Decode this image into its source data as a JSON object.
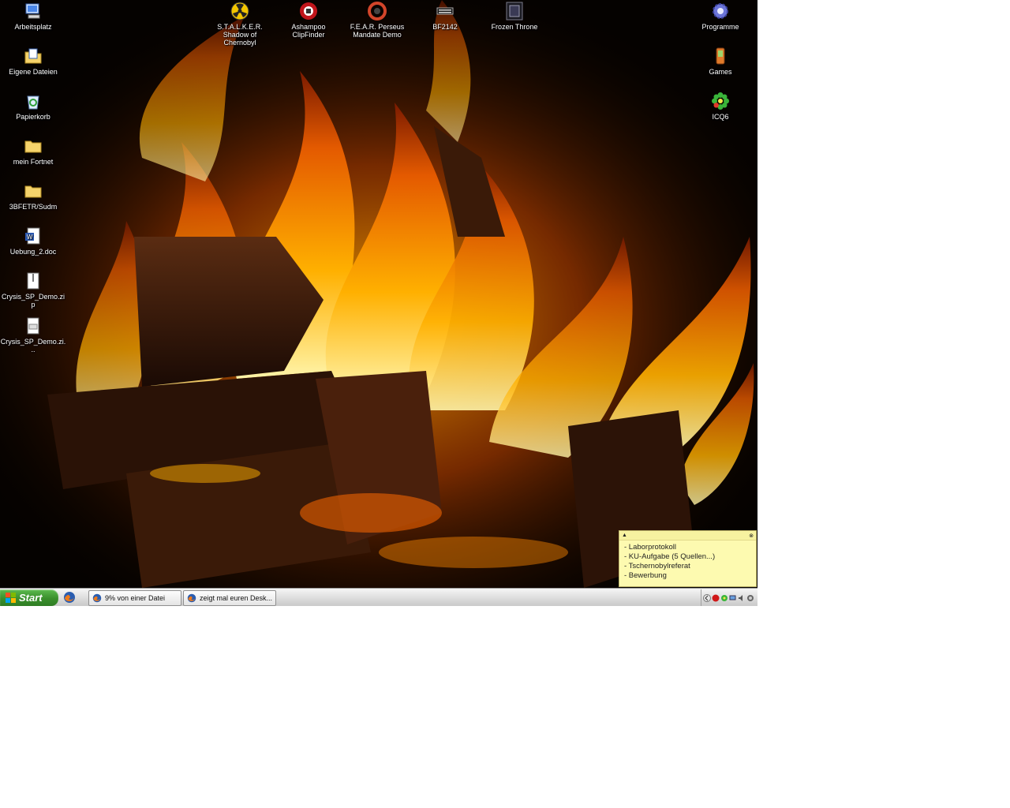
{
  "desktop": {
    "left_icons": [
      {
        "label": "Arbeitsplatz",
        "icon": "my-computer-icon"
      },
      {
        "label": "Eigene Dateien",
        "icon": "my-documents-icon"
      },
      {
        "label": "Papierkorb",
        "icon": "recycle-bin-icon"
      },
      {
        "label": "mein Fortnet",
        "icon": "folder-icon"
      },
      {
        "label": "3BFETR/Sudm",
        "icon": "folder-icon"
      },
      {
        "label": "Uebung_2.doc",
        "icon": "word-document-icon"
      },
      {
        "label": "Crysis_SP_Demo.zip",
        "icon": "zip-file-icon"
      },
      {
        "label": "Crysis_SP_Demo.zi...",
        "icon": "text-file-icon"
      }
    ],
    "top_icons": [
      {
        "label": "S.T.A.L.K.E.R. Shadow of Chernobyl",
        "icon": "radiation-icon"
      },
      {
        "label": "Ashampoo ClipFinder",
        "icon": "clipfinder-icon"
      },
      {
        "label": "F.E.A.R. Perseus Mandate Demo",
        "icon": "fear-icon"
      },
      {
        "label": "BF2142",
        "icon": "bf2142-icon"
      },
      {
        "label": "Frozen Throne",
        "icon": "frozen-throne-icon"
      }
    ],
    "right_icons": [
      {
        "label": "Programme",
        "icon": "gear-icon"
      },
      {
        "label": "Games",
        "icon": "pda-icon"
      },
      {
        "label": "ICQ6",
        "icon": "icq-flower-icon"
      }
    ]
  },
  "taskbar": {
    "start_label": "Start",
    "tasks": [
      {
        "label": "9% von einer Datei"
      },
      {
        "label": "zeigt mal euren Desk..."
      }
    ]
  },
  "note": {
    "items": [
      "- Laborprotokoll",
      "- KU-Aufgabe (5 Quellen...)",
      "- Tschernobylreferat",
      "- Bewerbung"
    ]
  },
  "colors": {
    "start_green": "#3a8f2c",
    "note_yellow": "#fdfab0",
    "flame_orange": "#ff8a00"
  }
}
